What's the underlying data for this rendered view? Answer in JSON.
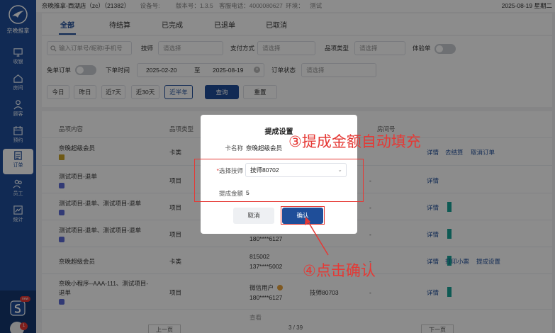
{
  "sidebar": {
    "brand": "奈晚推拿",
    "items": [
      {
        "label": "收银"
      },
      {
        "label": "房间"
      },
      {
        "label": "顾客"
      },
      {
        "label": "预约"
      },
      {
        "label": "订单"
      },
      {
        "label": "员工"
      },
      {
        "label": "统计"
      }
    ],
    "new_badge": "new",
    "notif_count": "1"
  },
  "topbar": {
    "store": "奈晚推拿-西湖店（zc）（21382）",
    "device": "设备号:",
    "version": "版本号：1.3.5",
    "hotline": "客服电话：4000080627",
    "env": "环境：",
    "env_value": "测试",
    "datetime": "2025-08-19 星期二"
  },
  "tabs": [
    "全部",
    "待结算",
    "已完成",
    "已退单",
    "已取消"
  ],
  "filters": {
    "search_placeholder": "输入订单号/昵称/手机号",
    "tech_label": "技师",
    "tech_placeholder": "请选择",
    "pay_label": "支付方式",
    "pay_placeholder": "请选择",
    "item_type_label": "品项类型",
    "item_type_placeholder": "请选择",
    "trial_label": "体验单",
    "free_label": "免单订单",
    "time_label": "下单时间",
    "date_start": "2025-02-20",
    "date_sep": "至",
    "date_end": "2025-08-19",
    "status_label": "订单状态",
    "status_placeholder": "请选择",
    "ranges": [
      "今日",
      "昨日",
      "近7天",
      "近30天",
      "近半年"
    ],
    "query": "查询",
    "reset": "重置"
  },
  "table": {
    "headers": [
      "品项内容",
      "品项类型",
      "房间号"
    ],
    "rows": [
      {
        "item": "奈晚超级会员",
        "type": "卡类",
        "actions": [
          "详情",
          "去结算",
          "取消订单"
        ]
      },
      {
        "item": "测试项目-退单",
        "type": "项目",
        "room": "-",
        "actions": [
          "详情"
        ]
      },
      {
        "item": "测试项目-退单、测试项目-退单",
        "type": "项目",
        "room": "-",
        "actions": [
          "详情"
        ]
      },
      {
        "item": "测试项目-退单、测试项目-退单",
        "type": "项目",
        "customer2": "180****6127",
        "room": "-",
        "actions": [
          "详情"
        ]
      },
      {
        "item": "奈晚超级会员",
        "type": "卡类",
        "customer1": "815002",
        "customer2": "137****5002",
        "room": "-",
        "actions": [
          "详情",
          "打印小票",
          "提成设置"
        ]
      },
      {
        "item1": "奈晚小程序--AAA-111、测试项目-",
        "item2": "退单",
        "type": "项目",
        "customer1": "微信用户",
        "customer2": "180****6127",
        "tech": "技师80703",
        "room": "-",
        "actions": [
          "详情"
        ]
      }
    ],
    "cut_row": "查看",
    "pager_prev": "上一页",
    "pager_info": "3 / 39",
    "pager_next": "下一页"
  },
  "modal": {
    "title": "提成设置",
    "card_label": "卡名称",
    "card_value": "奈晚超级会员",
    "tech_label": "选择技师",
    "tech_value": "技师80702",
    "amount_label": "提成金额",
    "amount_value": "5",
    "cancel": "取消",
    "confirm": "确认"
  },
  "annotations": {
    "step3": "③提成金额自动填充",
    "step4": "④点击确认",
    "color": "#e53935"
  }
}
